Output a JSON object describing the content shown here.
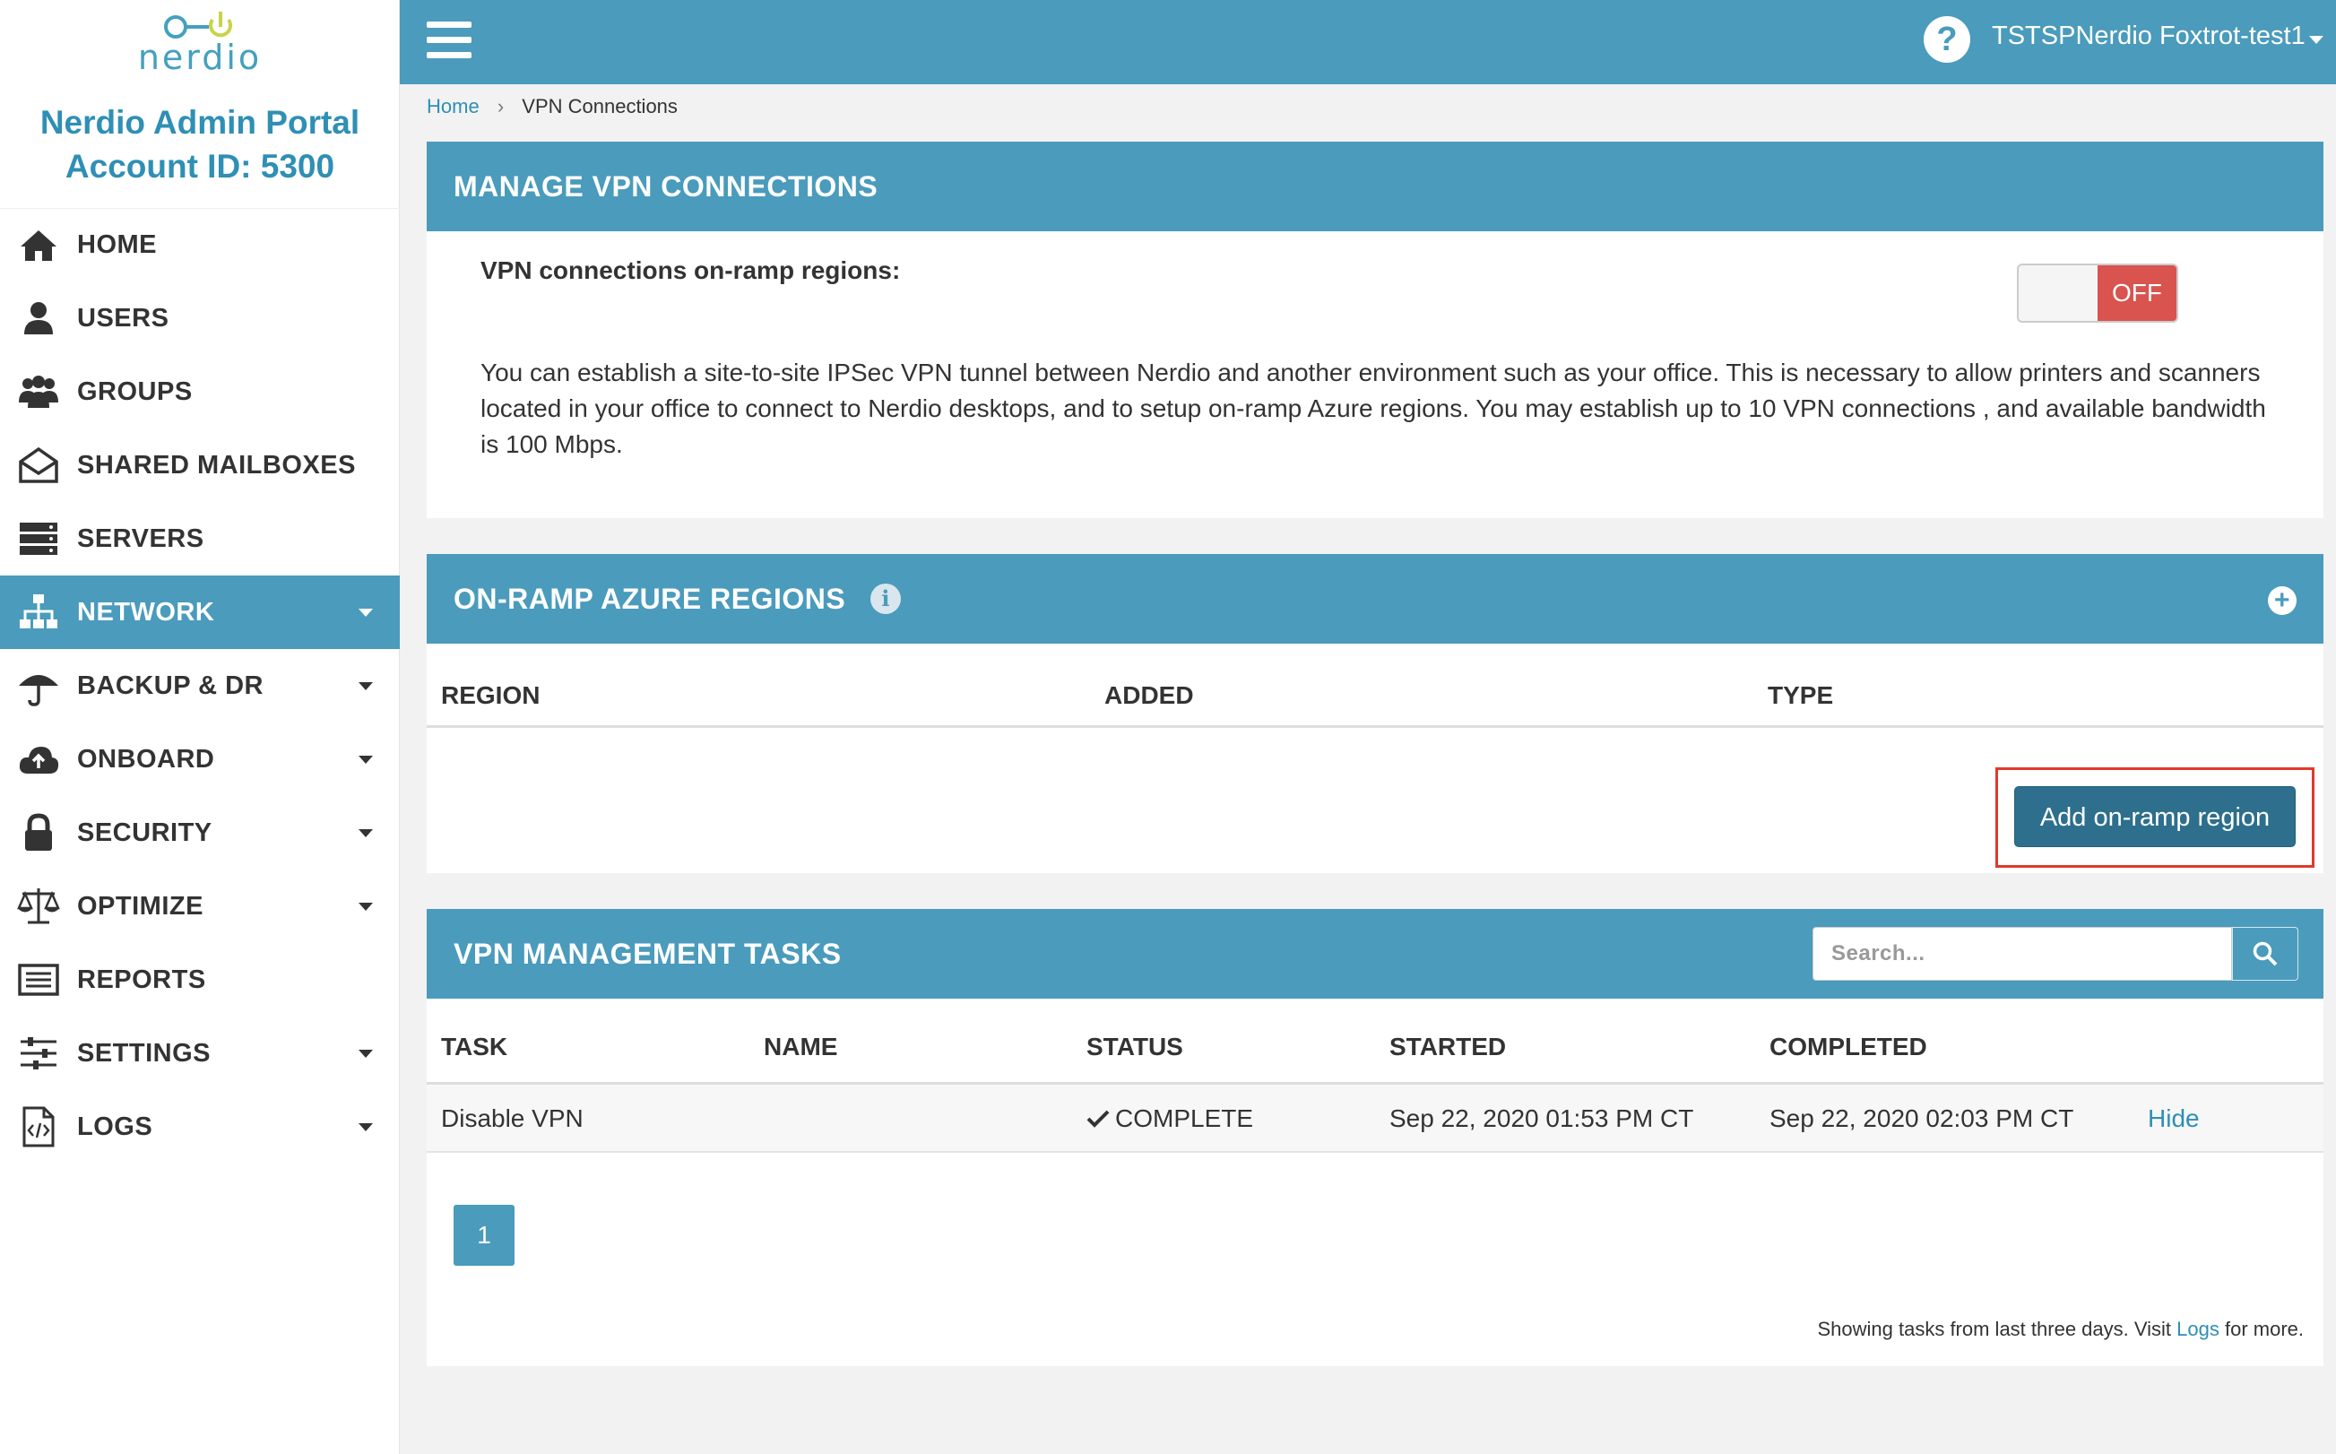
{
  "logo": {
    "text": "nerdio"
  },
  "sidebar": {
    "title": "Nerdio Admin Portal",
    "account": "Account ID: 5300",
    "items": [
      {
        "label": "HOME",
        "icon": "home-icon",
        "caret": false
      },
      {
        "label": "USERS",
        "icon": "user-icon",
        "caret": false
      },
      {
        "label": "GROUPS",
        "icon": "group-icon",
        "caret": false
      },
      {
        "label": "SHARED MAILBOXES",
        "icon": "mailbox-icon",
        "caret": false
      },
      {
        "label": "SERVERS",
        "icon": "server-icon",
        "caret": false
      },
      {
        "label": "NETWORK",
        "icon": "network-icon",
        "caret": true,
        "active": true
      },
      {
        "label": "BACKUP & DR",
        "icon": "umbrella-icon",
        "caret": true
      },
      {
        "label": "ONBOARD",
        "icon": "cloud-upload-icon",
        "caret": true
      },
      {
        "label": "SECURITY",
        "icon": "lock-icon",
        "caret": true
      },
      {
        "label": "OPTIMIZE",
        "icon": "balance-scale-icon",
        "caret": true
      },
      {
        "label": "REPORTS",
        "icon": "report-icon",
        "caret": false
      },
      {
        "label": "SETTINGS",
        "icon": "sliders-icon",
        "caret": true
      },
      {
        "label": "LOGS",
        "icon": "code-file-icon",
        "caret": true
      }
    ]
  },
  "topbar": {
    "help": "?",
    "user": "TSTSPNerdio Foxtrot-test1"
  },
  "breadcrumb": {
    "home": "Home",
    "separator": "›",
    "current": "VPN Connections"
  },
  "manage_vpn": {
    "title": "MANAGE VPN CONNECTIONS",
    "label": "VPN connections on-ramp regions:",
    "toggle": "OFF",
    "description": "You can establish a site-to-site IPSec VPN tunnel between Nerdio and another environment such as your office. This is necessary to allow printers and scanners located in your office to connect to Nerdio desktops, and to setup on-ramp Azure regions. You may establish up to 10 VPN connections , and available bandwidth is 100 Mbps."
  },
  "onramp": {
    "title": "ON-RAMP AZURE REGIONS",
    "info": "i",
    "plus": "+",
    "columns": [
      "REGION",
      "ADDED",
      "TYPE"
    ],
    "add_button": "Add on-ramp region"
  },
  "tasks": {
    "title": "VPN MANAGEMENT TASKS",
    "search_placeholder": "Search...",
    "columns": [
      "TASK",
      "NAME",
      "STATUS",
      "STARTED",
      "COMPLETED"
    ],
    "rows": [
      {
        "task": "Disable VPN",
        "name": "",
        "status": "COMPLETE",
        "started": "Sep 22, 2020 01:53 PM CT",
        "completed": "Sep 22, 2020 02:03 PM CT",
        "action": "Hide"
      }
    ],
    "page": "1",
    "footer_prefix": "Showing tasks from last three days. Visit ",
    "footer_link": "Logs",
    "footer_suffix": " for more."
  },
  "colors": {
    "brand": "#4a9bbc",
    "button_dark": "#2d6f8c",
    "off_red": "#d9534f",
    "highlight": "#e0392b"
  }
}
